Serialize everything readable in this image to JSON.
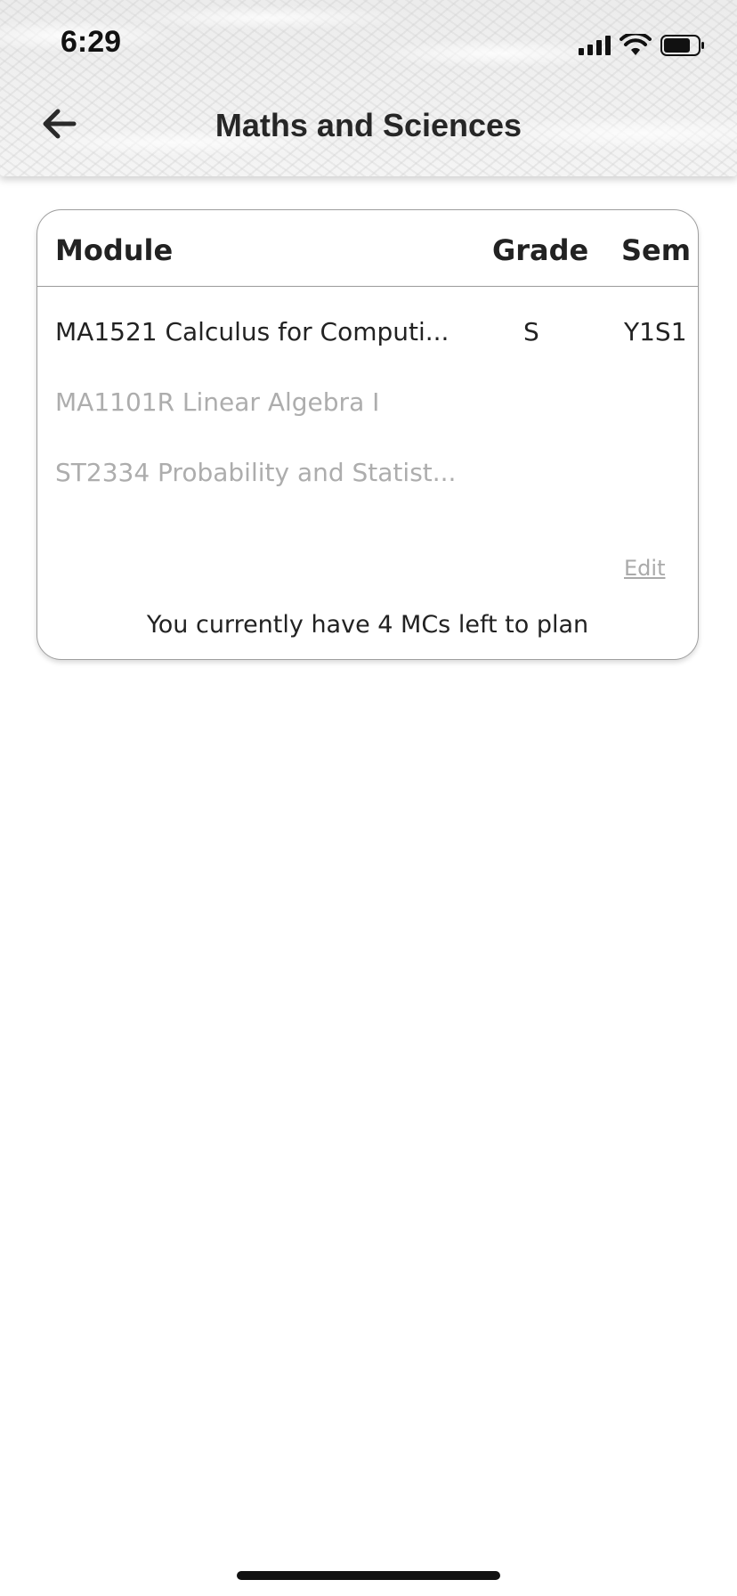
{
  "status_bar": {
    "time": "6:29",
    "icons": [
      "cellular-signal-icon",
      "wifi-icon",
      "battery-icon"
    ]
  },
  "header": {
    "back_icon": "arrow-left-icon",
    "title": "Maths and Sciences"
  },
  "table": {
    "columns": [
      "Module",
      "Grade",
      "Sem"
    ],
    "rows": [
      {
        "module": "MA1521 Calculus for Computi...",
        "grade": "S",
        "sem": "Y1S1",
        "state": "planned"
      },
      {
        "module": "MA1101R Linear Algebra I",
        "grade": "",
        "sem": "",
        "state": "unplanned"
      },
      {
        "module": "ST2334 Probability and Statist...",
        "grade": "",
        "sem": "",
        "state": "unplanned"
      }
    ],
    "edit_label": "Edit",
    "mc_note": "You currently have 4 MCs left to plan"
  },
  "colors": {
    "planned_text": "#222222",
    "unplanned_text": "#adadad",
    "card_border": "#9e9e9e"
  }
}
